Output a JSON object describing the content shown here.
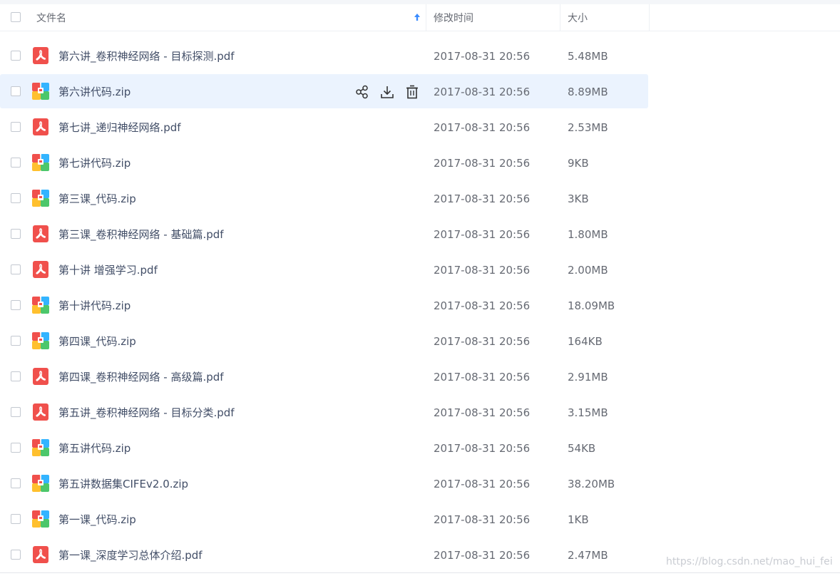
{
  "header": {
    "name_label": "文件名",
    "time_label": "修改时间",
    "size_label": "大小",
    "sort": "name-ascending"
  },
  "colors": {
    "accent": "#3b8cff",
    "highlight_row": "#ebf3fe",
    "pdf_icon": "#f0504c",
    "zip_icon": [
      "#f0504c",
      "#33b4ff",
      "#ffc02e",
      "#4cc76b"
    ]
  },
  "row_actions": [
    "share-icon",
    "download-icon",
    "delete-icon"
  ],
  "files": [
    {
      "name": "第六讲_卷积神经网络 - 目标探测.pdf",
      "type": "pdf",
      "time": "2017-08-31 20:56",
      "size": "5.48MB"
    },
    {
      "name": "第六讲代码.zip",
      "type": "zip",
      "time": "2017-08-31 20:56",
      "size": "8.89MB",
      "highlighted": true
    },
    {
      "name": "第七讲_递归神经网络.pdf",
      "type": "pdf",
      "time": "2017-08-31 20:56",
      "size": "2.53MB"
    },
    {
      "name": "第七讲代码.zip",
      "type": "zip",
      "time": "2017-08-31 20:56",
      "size": "9KB"
    },
    {
      "name": "第三课_代码.zip",
      "type": "zip",
      "time": "2017-08-31 20:56",
      "size": "3KB"
    },
    {
      "name": "第三课_卷积神经网络 - 基础篇.pdf",
      "type": "pdf",
      "time": "2017-08-31 20:56",
      "size": "1.80MB"
    },
    {
      "name": "第十讲 增强学习.pdf",
      "type": "pdf",
      "time": "2017-08-31 20:56",
      "size": "2.00MB"
    },
    {
      "name": "第十讲代码.zip",
      "type": "zip",
      "time": "2017-08-31 20:56",
      "size": "18.09MB"
    },
    {
      "name": "第四课_代码.zip",
      "type": "zip",
      "time": "2017-08-31 20:56",
      "size": "164KB"
    },
    {
      "name": "第四课_卷积神经网络 - 高级篇.pdf",
      "type": "pdf",
      "time": "2017-08-31 20:56",
      "size": "2.91MB"
    },
    {
      "name": "第五讲_卷积神经网络 - 目标分类.pdf",
      "type": "pdf",
      "time": "2017-08-31 20:56",
      "size": "3.15MB"
    },
    {
      "name": "第五讲代码.zip",
      "type": "zip",
      "time": "2017-08-31 20:56",
      "size": "54KB"
    },
    {
      "name": "第五讲数据集CIFEv2.0.zip",
      "type": "zip",
      "time": "2017-08-31 20:56",
      "size": "38.20MB"
    },
    {
      "name": "第一课_代码.zip",
      "type": "zip",
      "time": "2017-08-31 20:56",
      "size": "1KB"
    },
    {
      "name": "第一课_深度学习总体介绍.pdf",
      "type": "pdf",
      "time": "2017-08-31 20:56",
      "size": "2.47MB"
    }
  ],
  "watermark": "https://blog.csdn.net/mao_hui_fei"
}
